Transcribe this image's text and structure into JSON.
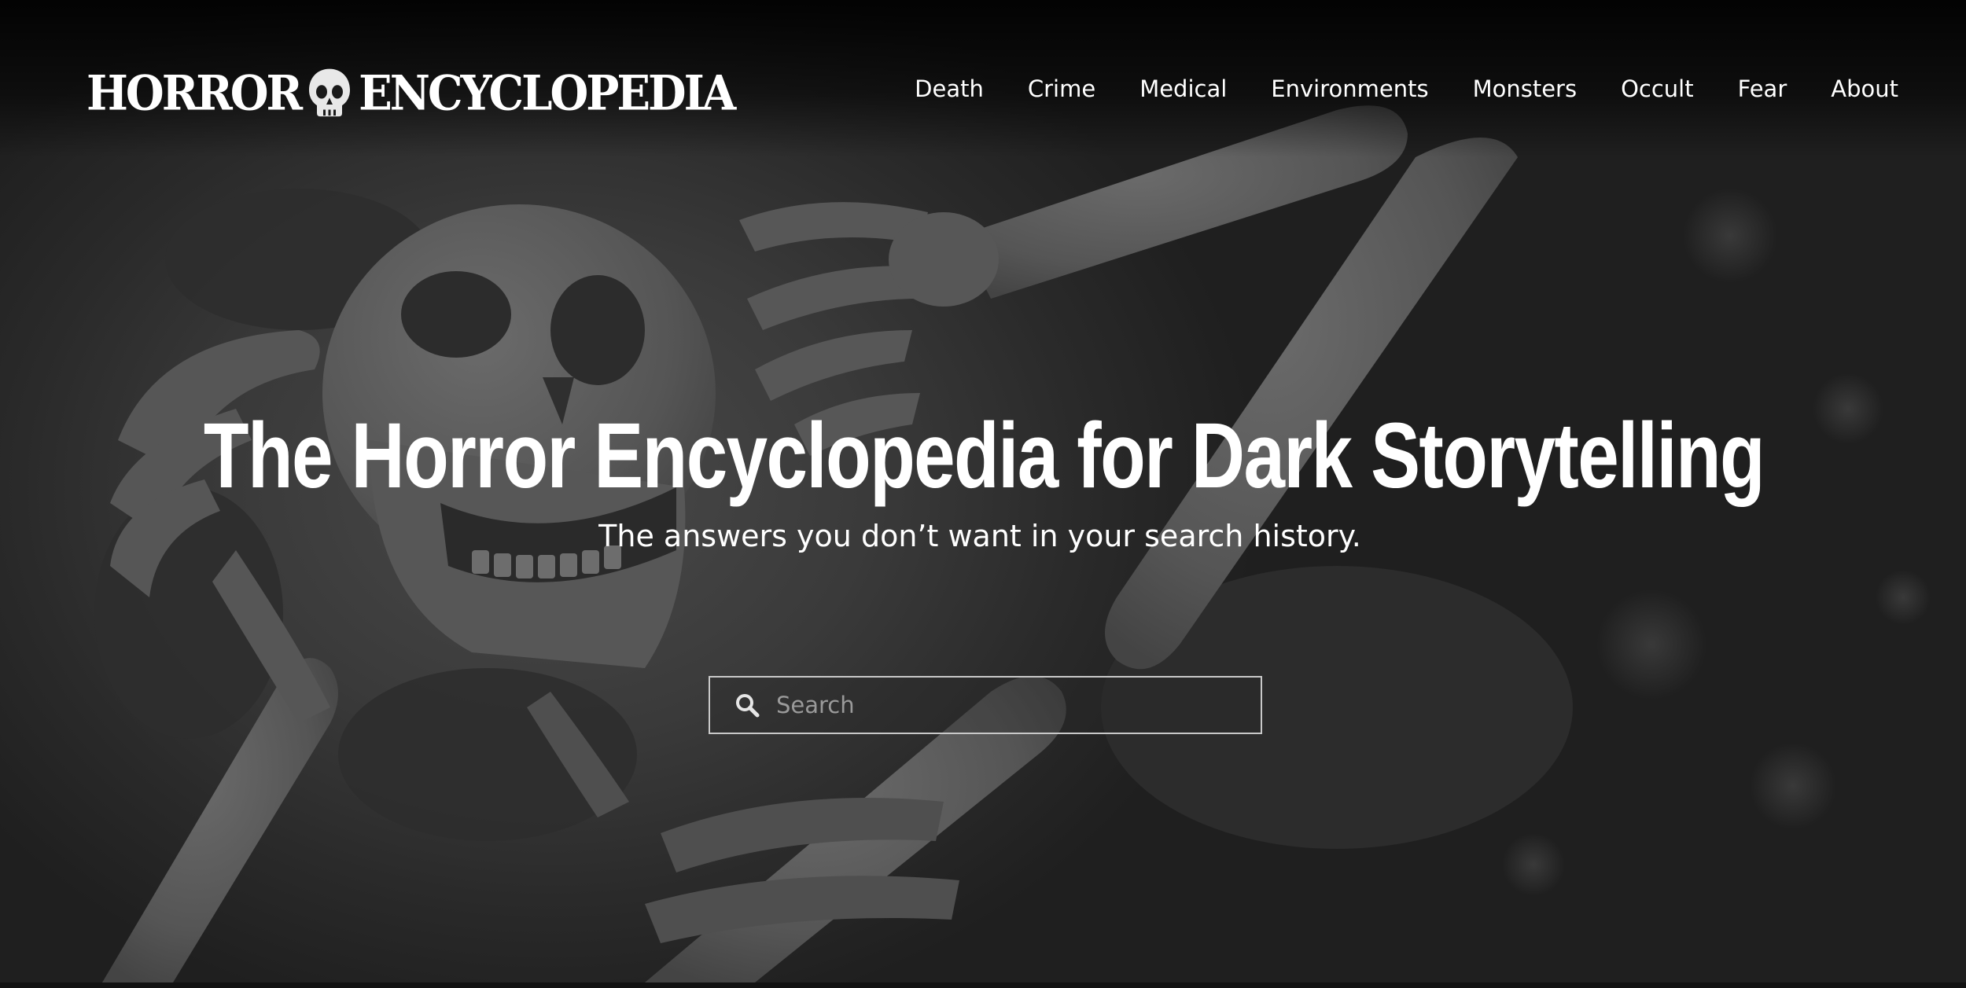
{
  "header": {
    "logo_left": "HORROR",
    "logo_right": "ENCYCLOPEDIA",
    "logo_icon": "skull-icon"
  },
  "nav": {
    "items": [
      {
        "label": "Death"
      },
      {
        "label": "Crime"
      },
      {
        "label": "Medical"
      },
      {
        "label": "Environments"
      },
      {
        "label": "Monsters"
      },
      {
        "label": "Occult"
      },
      {
        "label": "Fear"
      },
      {
        "label": "About"
      }
    ]
  },
  "hero": {
    "title": "The Horror Encyclopedia for Dark Storytelling",
    "subtitle": "The answers you don’t want in your search history.",
    "background_image": "skeleton-lying-in-foliage"
  },
  "search": {
    "placeholder": "Search",
    "value": "",
    "icon": "search-icon"
  },
  "colors": {
    "text": "#ffffff",
    "background": "#2a2a2a",
    "search_border": "#c9c9c9",
    "placeholder": "#9a9a9a"
  }
}
